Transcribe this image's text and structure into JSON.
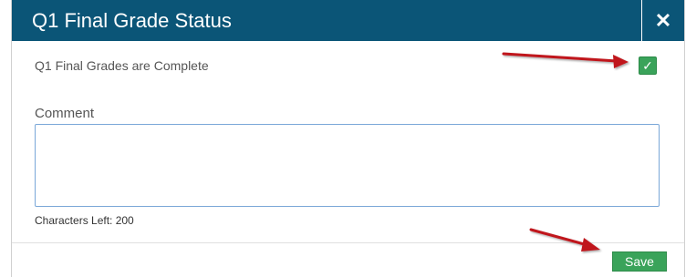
{
  "dialog": {
    "title": "Q1 Final Grade Status",
    "close_symbol": "✕",
    "complete_label": "Q1 Final Grades are Complete",
    "complete_checked": true,
    "checkbox_symbol": "✓",
    "comment_label": "Comment",
    "comment_value": "",
    "characters_left": "Characters Left: 200",
    "save_label": "Save"
  },
  "colors": {
    "header": "#0b5577",
    "accent_green": "#3aa35a",
    "annotation_arrow": "#c0161d"
  },
  "icons": {
    "close": "close-icon",
    "checkbox": "checkmark-icon",
    "annotations": "red-arrow-icon"
  }
}
